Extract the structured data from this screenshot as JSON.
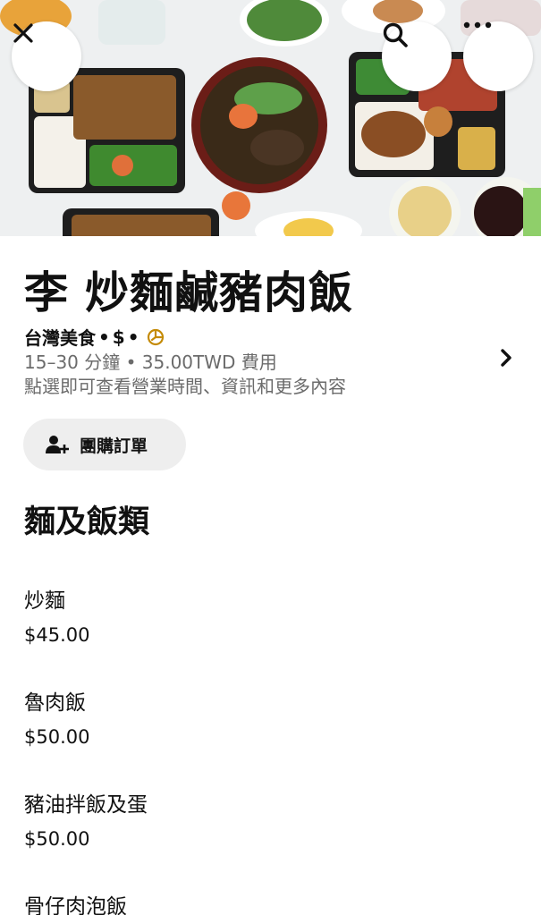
{
  "header": {
    "close_icon": "close-icon",
    "search_icon": "search-icon",
    "more_icon": "more-icon"
  },
  "store": {
    "name": "李 炒麵鹹豬肉飯",
    "cuisine": "台灣美食",
    "separator": "•",
    "price_level": "$",
    "badge_icon": "promo-badge-icon",
    "delivery_info": "15–30 分鐘 • 35.00TWD 費用",
    "details_hint": "點選即可查看營業時間、資訊和更多內容"
  },
  "group_order": {
    "label": "團購訂單",
    "icon": "add-person-icon"
  },
  "menu": {
    "section_title": "麵及飯類",
    "items": [
      {
        "name": "炒麵",
        "price": "$45.00"
      },
      {
        "name": "魯肉飯",
        "price": "$50.00"
      },
      {
        "name": "豬油拌飯及蛋",
        "price": "$50.00"
      },
      {
        "name": "骨仔肉泡飯",
        "price": ""
      }
    ]
  },
  "colors": {
    "accent_badge": "#c48a05",
    "muted_text": "#6b6b6b",
    "pill_bg": "#eeeeee"
  }
}
